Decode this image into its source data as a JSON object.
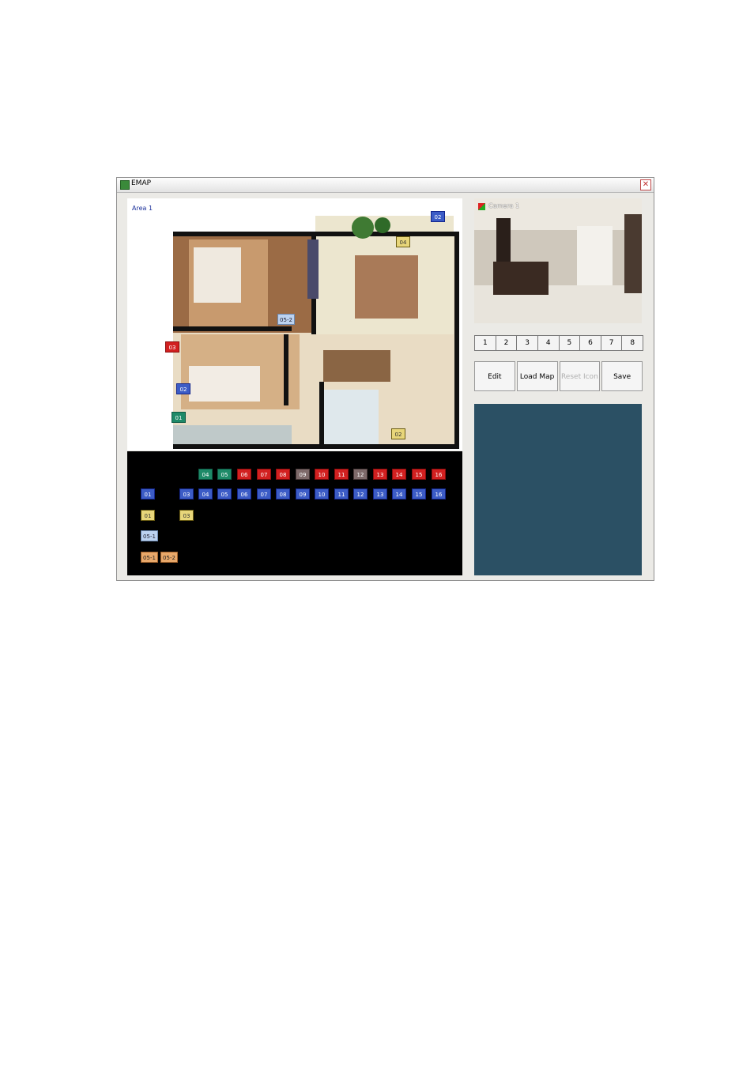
{
  "window": {
    "title": "EMAP",
    "close": "✕"
  },
  "map": {
    "area_label": "Area 1"
  },
  "placed_cameras": [
    {
      "label": "02",
      "color": "blue"
    },
    {
      "label": "04",
      "color": "yellow"
    },
    {
      "label": "05-2",
      "color": "light"
    },
    {
      "label": "03",
      "color": "red"
    },
    {
      "label": "02",
      "color": "blue"
    },
    {
      "label": "01",
      "color": "green"
    },
    {
      "label": "02",
      "color": "yellow"
    }
  ],
  "tray": {
    "row1": [
      "04",
      "05",
      "06",
      "07",
      "08",
      "09",
      "10",
      "11",
      "12",
      "13",
      "14",
      "15",
      "16"
    ],
    "row1_colors": [
      "green",
      "green",
      "red",
      "red",
      "red",
      "gray",
      "red",
      "red",
      "gray",
      "red",
      "red",
      "red",
      "red"
    ],
    "row2": [
      "01",
      "03",
      "04",
      "05",
      "06",
      "07",
      "08",
      "09",
      "10",
      "11",
      "12",
      "13",
      "14",
      "15",
      "16"
    ],
    "row3": [
      "01",
      "03"
    ],
    "row4": [
      "05-1"
    ],
    "row5": [
      "05-1",
      "05-2"
    ]
  },
  "preview": {
    "label": "Camera 1"
  },
  "channels": [
    "1",
    "2",
    "3",
    "4",
    "5",
    "6",
    "7",
    "8"
  ],
  "buttons": {
    "edit": "Edit",
    "load_map": "Load Map",
    "reset_icon": "Reset Icon",
    "save": "Save"
  }
}
